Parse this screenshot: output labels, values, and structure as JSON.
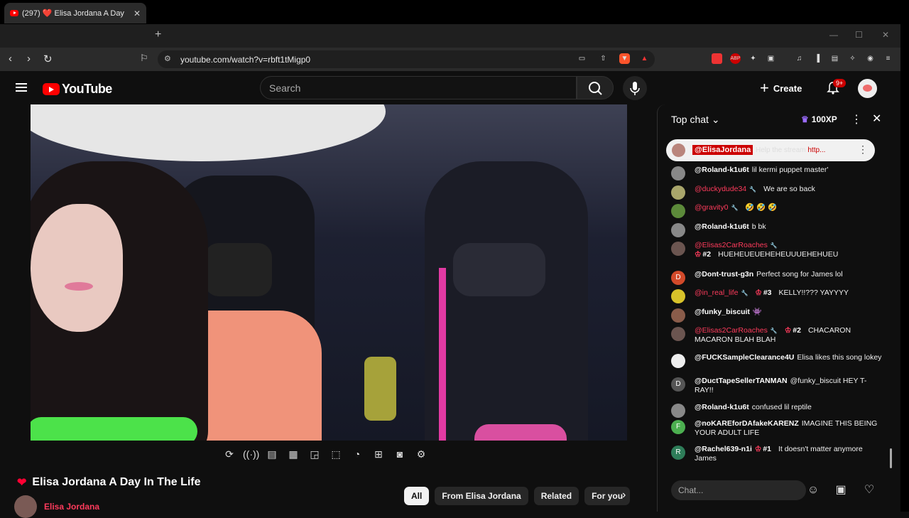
{
  "browser": {
    "tab_title": "(297) ❤️ Elisa Jordana A Day",
    "url": "youtube.com/watch?v=rbft1tMigp0",
    "new_tab": "+",
    "tab_close": "✕"
  },
  "header": {
    "logo_text": "YouTube",
    "search_placeholder": "Search",
    "create_label": "Create",
    "notif_badge": "9+"
  },
  "video": {
    "title": "Elisa Jordana A Day In The Life",
    "channel": "Elisa Jordana"
  },
  "chips": [
    "All",
    "From Elisa Jordana",
    "Related",
    "For you"
  ],
  "chat": {
    "header": "Top chat",
    "xp": "100XP",
    "pinned_user": "@ElisaJordana",
    "pinned_msg": "Help the stream",
    "pinned_link": "http...",
    "input_placeholder": "Chat...",
    "messages": [
      {
        "user": "@Roland-k1u6t",
        "text": "lil kermi puppet master'",
        "mod": false,
        "rank": "",
        "av": ""
      },
      {
        "user": "@duckydude34",
        "text": "We are so back",
        "mod": true,
        "rank": "",
        "av": ""
      },
      {
        "user": "@gravity0",
        "text": "🤣 🤣 🤣",
        "mod": true,
        "rank": "",
        "av": ""
      },
      {
        "user": "@Roland-k1u6t",
        "text": "b bk",
        "mod": false,
        "rank": "",
        "av": ""
      },
      {
        "user": "@Elisas2CarRoaches",
        "text": "HUEHEUEUEHEHEUUUEHEHUEU",
        "mod": true,
        "rank": "#2",
        "av": ""
      },
      {
        "user": "@Dont-trust-g3n",
        "text": "Perfect song for James lol",
        "mod": false,
        "rank": "",
        "av": "D"
      },
      {
        "user": "@in_real_life",
        "text": "KELLY!!??? YAYYYY",
        "mod": true,
        "rank": "#3",
        "av": ""
      },
      {
        "user": "@funky_biscuit",
        "text": "👾",
        "mod": false,
        "rank": "",
        "av": ""
      },
      {
        "user": "@Elisas2CarRoaches",
        "text": "CHACARON MACARON BLAH BLAH",
        "mod": true,
        "rank": "#2",
        "av": ""
      },
      {
        "user": "@FUCKSampleClearance4U",
        "text": "Elisa likes this song lokey",
        "mod": false,
        "rank": "",
        "av": ""
      },
      {
        "user": "@DuctTapeSellerTANMAN",
        "text": "@funky_biscuit HEY T-RAY!!",
        "mod": false,
        "rank": "",
        "av": "D"
      },
      {
        "user": "@Roland-k1u6t",
        "text": "confused lil reptile",
        "mod": false,
        "rank": "",
        "av": ""
      },
      {
        "user": "@noKAREforDAfakeKARENZ",
        "text": "IMAGINE THIS BEING YOUR ADULT LIFE",
        "mod": false,
        "rank": "",
        "av": "F"
      },
      {
        "user": "@Rachel639-n1i",
        "text": "It doesn't matter anymore James",
        "mod": false,
        "rank": "#1",
        "av": "R"
      }
    ]
  },
  "colors": {
    "accent": "#ff0000",
    "mod_name": "#ff3b5c",
    "bg": "#0f0f0f"
  }
}
